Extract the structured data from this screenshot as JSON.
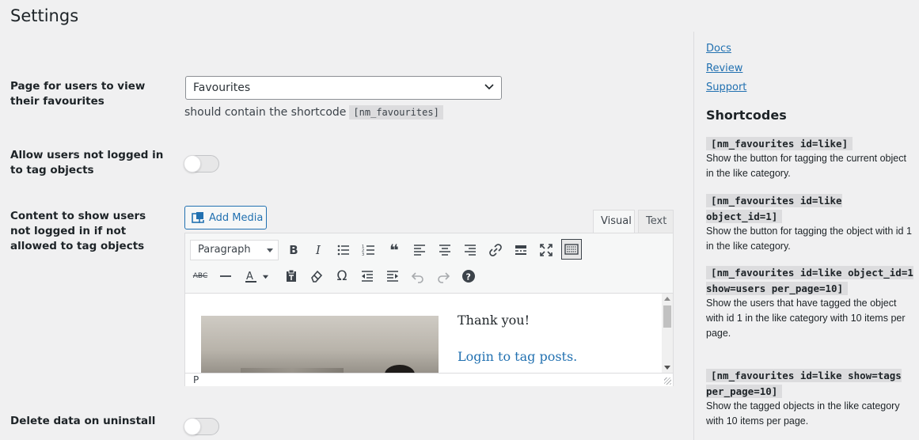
{
  "page": {
    "title": "Settings"
  },
  "fields": {
    "favourites_page": {
      "label": "Page for users to view their favourites",
      "selected": "Favourites",
      "hint_text": "should contain the shortcode",
      "hint_code": "[nm_favourites]"
    },
    "allow_guests": {
      "label": "Allow users not logged in to tag objects",
      "enabled": false
    },
    "guest_content": {
      "label": "Content to show users not logged in if not allowed to tag objects"
    },
    "delete_data": {
      "label": "Delete data on uninstall",
      "enabled": false
    }
  },
  "editor": {
    "add_media_label": "Add Media",
    "tabs": {
      "visual": "Visual",
      "text": "Text"
    },
    "format_select": "Paragraph",
    "content": {
      "line1": "Thank you!",
      "link": "Login to tag posts."
    },
    "status_path": "P"
  },
  "sidebar": {
    "links": {
      "docs": "Docs",
      "review": "Review",
      "support": "Support"
    },
    "heading": "Shortcodes",
    "shortcodes": [
      {
        "code": "[nm_favourites id=like]",
        "desc": "Show the button for tagging the current object in the like category."
      },
      {
        "code": "[nm_favourites id=like object_id=1]",
        "desc": "Show the button for tagging the object with id 1 in the like category."
      },
      {
        "code": "[nm_favourites id=like object_id=1 show=users per_page=10]",
        "desc": "Show the users that have tagged the object with id 1 in the like category with 10 items per page."
      },
      {
        "code": "[nm_favourites id=like show=tags per_page=10]",
        "desc": "Show the tagged objects in the like category with 10 items per page."
      }
    ]
  },
  "colors": {
    "link": "#2271b1",
    "background": "#f0f0f1"
  }
}
